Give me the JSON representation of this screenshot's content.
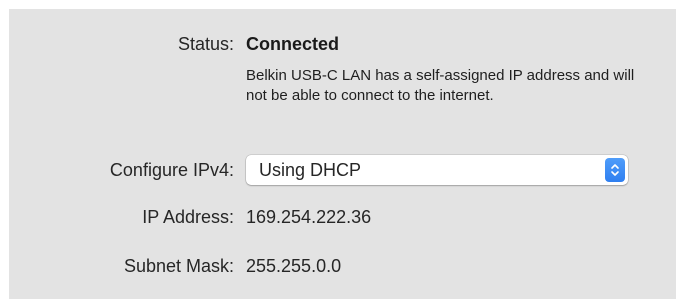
{
  "status": {
    "label": "Status:",
    "value": "Connected",
    "description": "Belkin USB-C LAN has a self-assigned IP address and will not be able to connect to the internet."
  },
  "configure_ipv4": {
    "label": "Configure IPv4:",
    "selected": "Using DHCP",
    "icon": "up-down-chevron-icon",
    "accent_color": "#3a8bf5"
  },
  "ip_address": {
    "label": "IP Address:",
    "value": "169.254.222.36"
  },
  "subnet_mask": {
    "label": "Subnet Mask:",
    "value": "255.255.0.0"
  }
}
